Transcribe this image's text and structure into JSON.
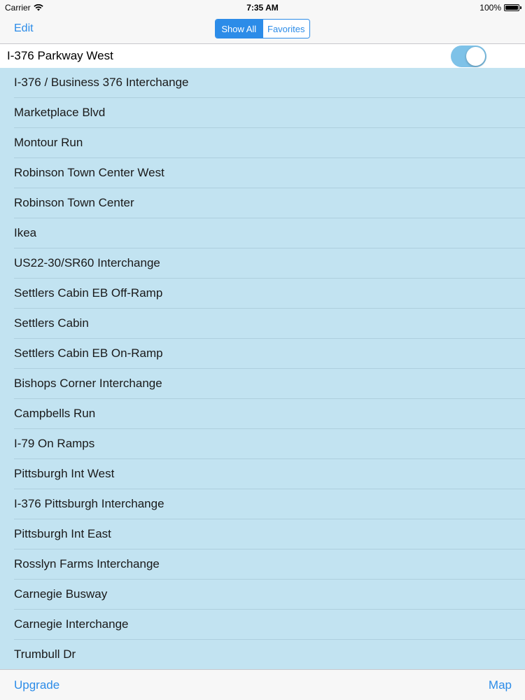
{
  "status_bar": {
    "carrier": "Carrier",
    "time": "7:35 AM",
    "battery": "100%"
  },
  "nav": {
    "edit_label": "Edit",
    "segments": [
      {
        "label": "Show All",
        "selected": true
      },
      {
        "label": "Favorites",
        "selected": false
      }
    ]
  },
  "toggle_row": {
    "label": "I-376 Parkway West",
    "on": true
  },
  "list": {
    "items": [
      "I-376 / Business 376 Interchange",
      "Marketplace Blvd",
      "Montour Run",
      "Robinson Town Center West",
      "Robinson Town Center",
      "Ikea",
      "US22-30/SR60 Interchange",
      "Settlers Cabin EB Off-Ramp",
      "Settlers Cabin",
      "Settlers Cabin EB On-Ramp",
      "Bishops Corner Interchange",
      "Campbells Run",
      "I-79 On Ramps",
      "Pittsburgh Int West",
      "I-376 Pittsburgh Interchange",
      "Pittsburgh Int East",
      "Rosslyn Farms Interchange",
      "Carnegie Busway",
      "Carnegie Interchange",
      "Trumbull Dr"
    ]
  },
  "toolbar": {
    "upgrade_label": "Upgrade",
    "map_label": "Map"
  },
  "colors": {
    "accent": "#2c8ce8",
    "list_background": "#c2e3f1",
    "switch_on": "#7ec2e8"
  },
  "icons": {
    "wifi": "wifi-icon",
    "battery": "battery-icon"
  }
}
